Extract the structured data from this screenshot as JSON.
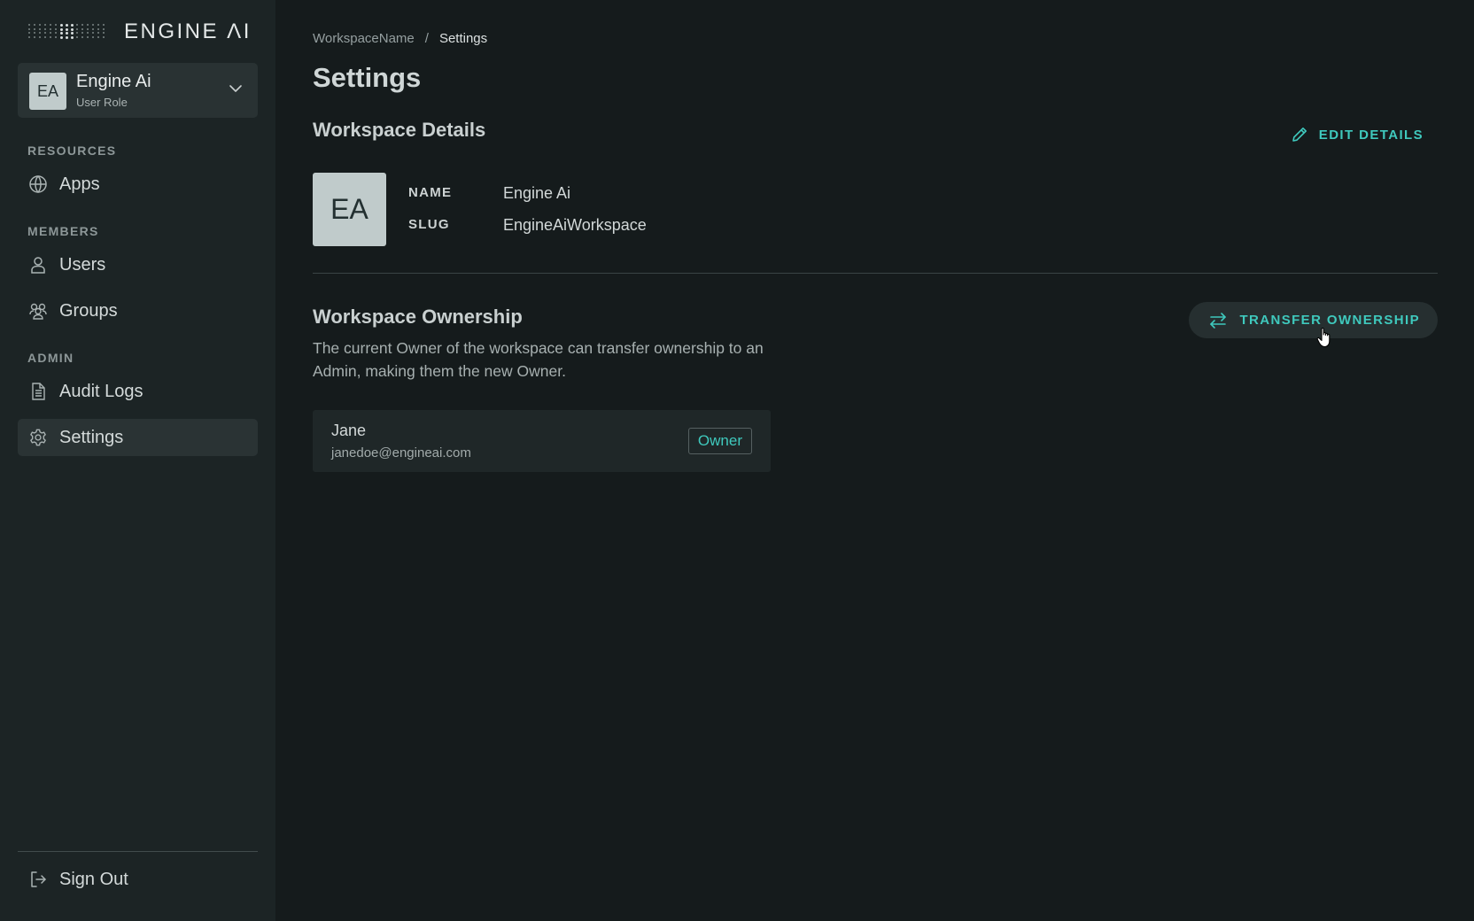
{
  "brand": {
    "name": "ENGINE ΛI"
  },
  "workspace_switcher": {
    "initials": "EA",
    "name": "Engine Ai",
    "role": "User Role"
  },
  "sidebar": {
    "sections": [
      {
        "label": "RESOURCES",
        "items": [
          {
            "label": "Apps",
            "icon": "globe-icon"
          }
        ]
      },
      {
        "label": "MEMBERS",
        "items": [
          {
            "label": "Users",
            "icon": "user-icon"
          },
          {
            "label": "Groups",
            "icon": "group-icon"
          }
        ]
      },
      {
        "label": "ADMIN",
        "items": [
          {
            "label": "Audit Logs",
            "icon": "document-icon"
          },
          {
            "label": "Settings",
            "icon": "gear-icon",
            "active": true
          }
        ]
      }
    ],
    "sign_out": {
      "label": "Sign Out",
      "icon": "sign-out-icon"
    }
  },
  "breadcrumb": {
    "workspace": "WorkspaceName",
    "separator": "/",
    "current": "Settings"
  },
  "page": {
    "title": "Settings"
  },
  "workspace_details": {
    "title": "Workspace Details",
    "edit_label": "EDIT DETAILS",
    "initials": "EA",
    "fields": [
      {
        "key": "NAME",
        "value": "Engine Ai"
      },
      {
        "key": "SLUG",
        "value": "EngineAiWorkspace"
      }
    ]
  },
  "workspace_ownership": {
    "title": "Workspace Ownership",
    "description": "The current Owner of the workspace can transfer ownership to an Admin, making them the new Owner.",
    "transfer_label": "TRANSFER OWNERSHIP",
    "owner": {
      "name": "Jane",
      "email": "janedoe@engineai.com",
      "badge": "Owner"
    }
  },
  "colors": {
    "accent": "#3fc9bd",
    "background": "#151b1c",
    "sidebar": "#1c2425"
  }
}
